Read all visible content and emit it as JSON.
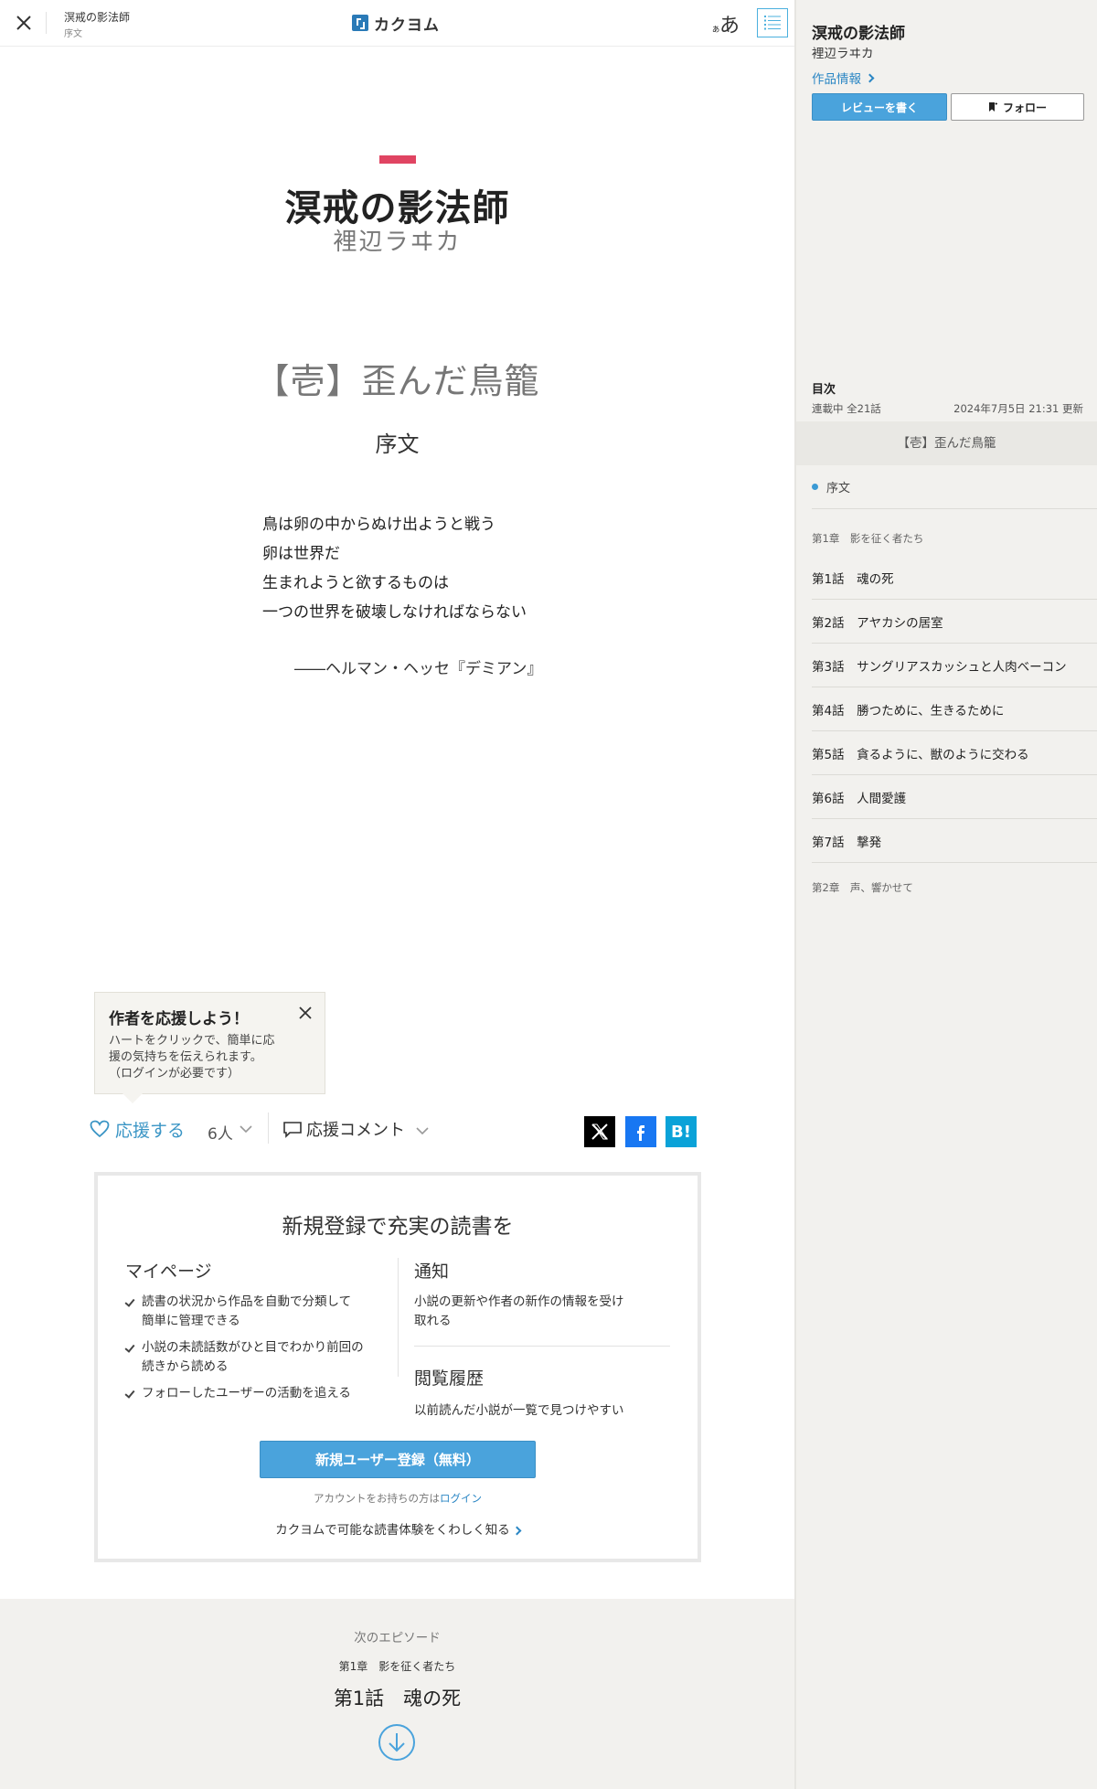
{
  "header": {
    "work_title": "溟戒の影法師",
    "episode": "序文",
    "logo_text": "カクヨム",
    "font_small": "ぁ",
    "font_big": "あ"
  },
  "content": {
    "work_title": "溟戒の影法師",
    "author": "裡辺ラヰカ",
    "arc_title": "【壱】歪んだ鳥籠",
    "episode_title": "序文",
    "poem": [
      "鳥は卵の中からぬけ出ようと戦う",
      "卵は世界だ",
      "生まれようと欲するものは",
      "一つの世界を破壊しなければならない"
    ],
    "citation": "――ヘルマン・ヘッセ『デミアン』"
  },
  "tooltip": {
    "title": "作者を応援しよう！",
    "body_lines": [
      "ハートをクリックで、簡単に応",
      "援の気持ちを伝えられます。",
      "（ログインが必要です）"
    ]
  },
  "actions": {
    "cheer_label": "応援する",
    "cheer_count": "6人",
    "comment_label": "応援コメント",
    "hatena_label": "B!"
  },
  "register": {
    "heading": "新規登録で充実の読書を",
    "mypage_title": "マイページ",
    "mypage_items": [
      [
        "読書の状況から作品を自動で分類して",
        "簡単に管理できる"
      ],
      [
        "小説の未読話数がひと目でわかり前回の",
        "続きから読める"
      ],
      [
        "フォローしたユーザーの活動を追える"
      ]
    ],
    "notify_title": "通知",
    "notify_desc": [
      "小説の更新や作者の新作の情報を受け",
      "取れる"
    ],
    "history_title": "閲覧履歴",
    "history_desc": "以前読んだ小説が一覧で見つけやすい",
    "button_label": "新規ユーザー登録（無料）",
    "login_prefix": "アカウントをお持ちの方は",
    "login_link": "ログイン",
    "learn_more": "カクヨムで可能な読書体験をくわしく知る"
  },
  "next": {
    "label": "次のエピソード",
    "chapter": "第1章　影を征く者たち",
    "title": "第1話　魂の死"
  },
  "sidebar": {
    "title": "溟戒の影法師",
    "author": "裡辺ラヰカ",
    "info_link": "作品情報",
    "review_button": "レビューを書く",
    "follow_button": "フォロー",
    "toc_label": "目次",
    "status": "連載中 全21話",
    "updated": "2024年7月5日 21:31 更新",
    "arc": "【壱】歪んだ鳥籠",
    "current_episode": "序文",
    "chapter1": "第1章　影を征く者たち",
    "episodes": [
      "第1話　魂の死",
      "第2話　アヤカシの居室",
      "第3話　サングリアスカッシュと人肉ベーコン",
      "第4話　勝つために、生きるために",
      "第5話　貪るように、獣のように交わる",
      "第6話　人間愛護",
      "第7話　撃発"
    ],
    "chapter2": "第2章　声、響かせて"
  },
  "colors": {
    "accent_blue": "#4aa3dc",
    "link_blue": "#2a86c4",
    "title_red": "#e04462",
    "sidebar_bg": "#f2f1ee"
  },
  "icons": {
    "close": "close-icon",
    "toc": "list-icon",
    "heart": "heart-icon",
    "comment": "speech-bubble-icon",
    "x": "x-logo-icon",
    "facebook": "facebook-icon",
    "hatena": "hatena-bookmark-icon",
    "next": "arrow-down-circle-icon",
    "follow": "bookmark-plus-icon"
  }
}
